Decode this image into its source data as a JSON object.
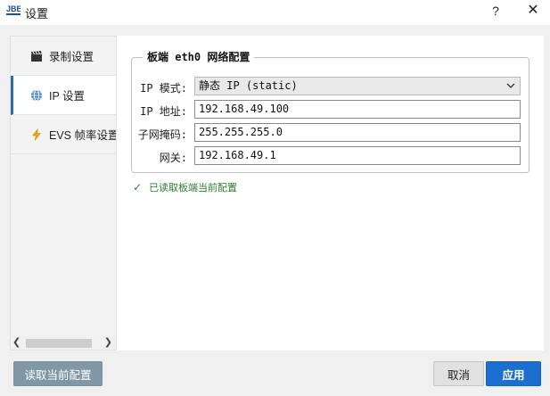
{
  "window": {
    "title": "设置",
    "help_label": "?",
    "close_label": "✕"
  },
  "sidebar": {
    "items": [
      {
        "label": "录制设置",
        "icon": "clapperboard-icon"
      },
      {
        "label": "IP 设置",
        "icon": "globe-icon"
      },
      {
        "label": "EVS 帧率设置",
        "icon": "lightning-icon"
      }
    ],
    "active_index": 1
  },
  "network": {
    "group_title": "板端 eth0 网络配置",
    "ip_mode_label": "IP 模式:",
    "ip_mode_value": "静态 IP (static)",
    "ip_label": "IP 地址:",
    "ip_value": "192.168.49.100",
    "mask_label": "子网掩码:",
    "mask_value": "255.255.255.0",
    "gateway_label": "网关:",
    "gateway_value": "192.168.49.1"
  },
  "status": {
    "check": "✓",
    "text": "已读取板端当前配置",
    "color": "#2e7d32"
  },
  "buttons": {
    "read_current": "读取当前配置",
    "cancel": "取消",
    "apply": "应用"
  },
  "colors": {
    "accent": "#1a6fd1",
    "read_button": "#7f97a6"
  }
}
